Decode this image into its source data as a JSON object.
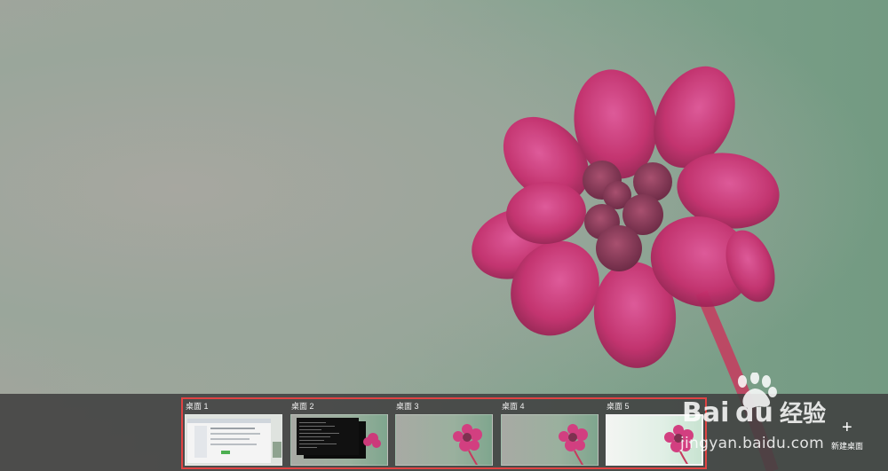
{
  "desktops": [
    {
      "label": "桌面 1"
    },
    {
      "label": "桌面 2"
    },
    {
      "label": "桌面 3"
    },
    {
      "label": "桌面 4"
    },
    {
      "label": "桌面 5",
      "active": true
    }
  ],
  "new_desktop": {
    "label": "新建桌面",
    "icon": "plus-icon"
  },
  "watermark": {
    "brand": "Bai du 经验",
    "url": "jingyan.baidu.com"
  },
  "colors": {
    "highlight": "#e04343",
    "taskview_bg": "#404040",
    "flower": "#d63a7a"
  }
}
